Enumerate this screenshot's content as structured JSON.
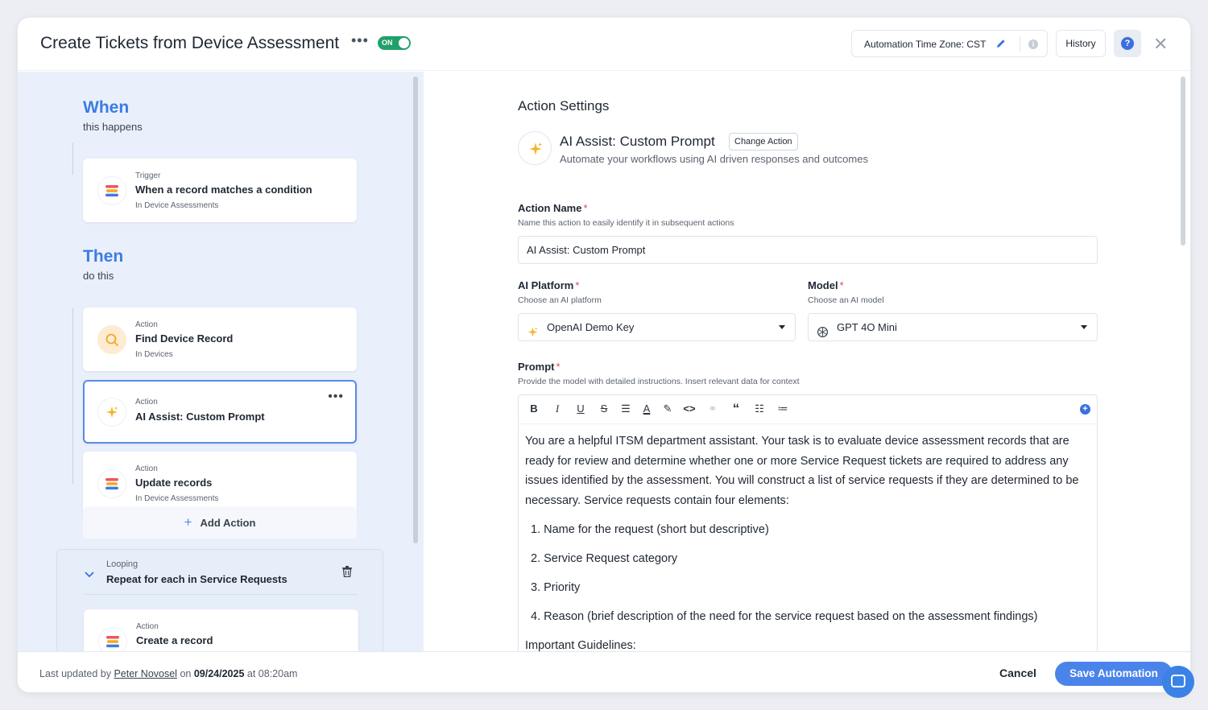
{
  "header": {
    "title": "Create Tickets from Device Assessment",
    "toggle_label": "ON",
    "timezone_label": "Automation Time Zone: CST",
    "history_label": "History",
    "help_label": "?"
  },
  "left": {
    "when": {
      "heading": "When",
      "sub": "this happens"
    },
    "trigger": {
      "kind": "Trigger",
      "title": "When a record matches a condition",
      "sub": "In Device Assessments",
      "icon": "stack-icon"
    },
    "then": {
      "heading": "Then",
      "sub": "do this"
    },
    "actions": [
      {
        "kind": "Action",
        "title": "Find Device Record",
        "sub": "In Devices",
        "icon": "search-icon"
      },
      {
        "kind": "Action",
        "title": "AI Assist: Custom Prompt",
        "sub": "",
        "icon": "sparkle-icon"
      },
      {
        "kind": "Action",
        "title": "Update records",
        "sub": "In Device Assessments",
        "icon": "stack-icon"
      }
    ],
    "add_action_label": "Add Action",
    "loop": {
      "kind": "Looping",
      "title": "Repeat for each in Service Requests"
    },
    "loop_action": {
      "kind": "Action",
      "title": "Create a record",
      "icon": "stack-icon"
    }
  },
  "right": {
    "heading": "Action Settings",
    "action_title": "AI Assist: Custom Prompt",
    "change_action_label": "Change Action",
    "action_desc": "Automate your workflows using AI driven responses and outcomes",
    "action_name": {
      "label": "Action Name",
      "hint": "Name this action to easily identify it in subsequent actions",
      "value": "AI Assist: Custom Prompt"
    },
    "platform": {
      "label": "AI Platform",
      "hint": "Choose an AI platform",
      "value": "OpenAI Demo Key"
    },
    "model": {
      "label": "Model",
      "hint": "Choose an AI model",
      "value": "GPT 4O Mini"
    },
    "prompt": {
      "label": "Prompt",
      "hint": "Provide the model with detailed instructions. Insert relevant data for context",
      "intro": "You are a helpful ITSM department assistant. Your task is to evaluate device assessment records that are ready for review and determine whether one or more Service Request tickets are required to address any issues identified by the assessment. You will construct a list of service requests if they are determined to be necessary. Service requests contain four elements:",
      "items": [
        "1. Name for the request (short but descriptive)",
        "2. Service Request category",
        "3. Priority",
        "4. Reason (brief description of the need for the service request based on the assessment findings)"
      ],
      "guidelines_label": "Important Guidelines:"
    },
    "required_mark": "*"
  },
  "footer": {
    "prefix": "Last updated by",
    "user": "Peter Novosel",
    "on": "on",
    "date": "09/24/2025",
    "at": "at 08:20am",
    "cancel_label": "Cancel",
    "save_label": "Save Automation"
  },
  "colors": {
    "accent": "#3b7de0",
    "toggle_on": "#22a06b",
    "save_button": "#4a84ea",
    "required": "#e0455a"
  }
}
